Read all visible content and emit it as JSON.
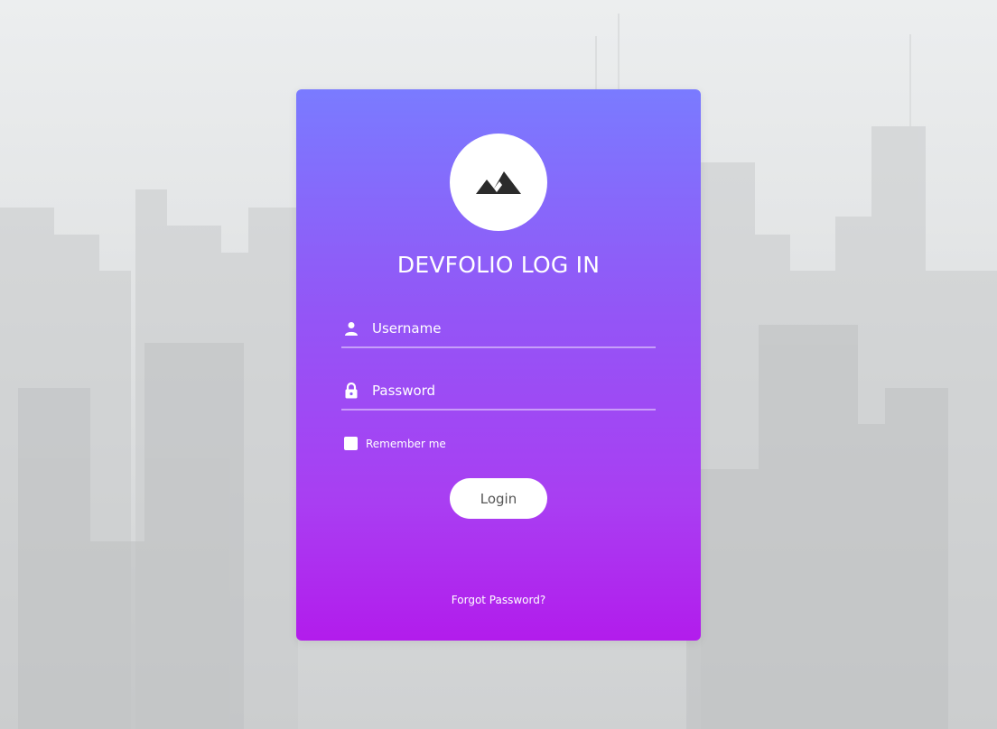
{
  "login_card": {
    "title": "DEVFOLIO LOG IN",
    "logo_icon": "mountains-icon",
    "username": {
      "icon": "user-icon",
      "placeholder": "Username",
      "value": ""
    },
    "password": {
      "icon": "lock-icon",
      "placeholder": "Password",
      "value": ""
    },
    "remember_me": {
      "label": "Remember me",
      "checked": false
    },
    "login_button": "Login",
    "forgot_password": "Forgot Password?"
  },
  "colors": {
    "gradient_top": "#7a7bff",
    "gradient_bottom": "#b21cec",
    "button_bg": "#ffffff",
    "button_text": "#555555",
    "page_background": "#dfe1e3"
  }
}
